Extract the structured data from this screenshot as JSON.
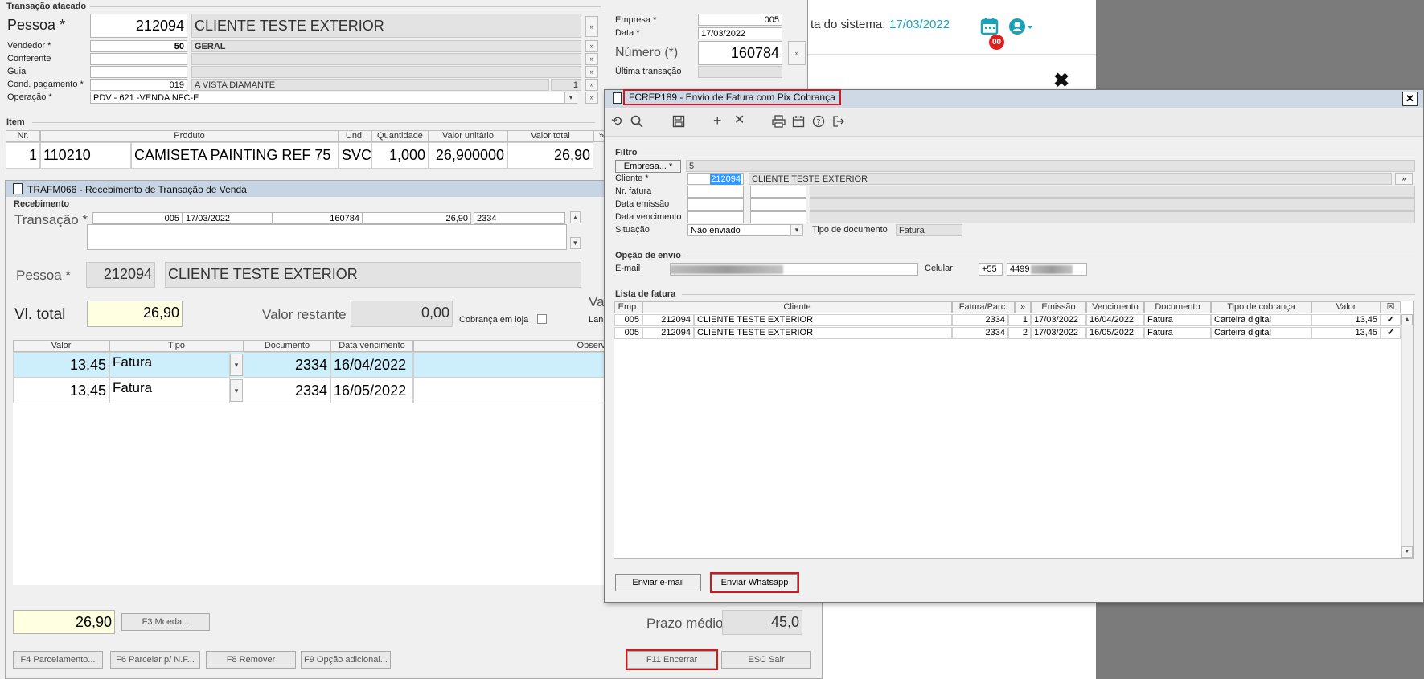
{
  "back_header": {
    "date_label": "ta do sistema:",
    "date_value": "17/03/2022",
    "badge": "00",
    "close": "✖"
  },
  "main": {
    "group_title": "Transação atacado",
    "pessoa": {
      "label": "Pessoa *",
      "code": "212094",
      "name": "CLIENTE TESTE EXTERIOR"
    },
    "vendedor": {
      "label": "Vendedor *",
      "code": "50",
      "name": "GERAL"
    },
    "conferente": {
      "label": "Conferente"
    },
    "guia": {
      "label": "Guia"
    },
    "cond_pag": {
      "label": "Cond. pagamento *",
      "code": "019",
      "name": "A VISTA DIAMANTE",
      "num": "1"
    },
    "operacao": {
      "label": "Operação *",
      "value": "PDV - 621 -VENDA NFC-E"
    },
    "empresa": {
      "label": "Empresa *",
      "value": "005"
    },
    "data": {
      "label": "Data *",
      "value": "17/03/2022"
    },
    "numero": {
      "label": "Número (*)",
      "value": "160784"
    },
    "ultima": {
      "label": "Última transação"
    },
    "item_group": "Item",
    "item_cols": [
      "Nr.",
      "Produto",
      "Und.",
      "Quantidade",
      "Valor unitário",
      "Valor total"
    ],
    "item_row": [
      "1",
      "110210",
      "CAMISETA PAINTING REF 75",
      "SVC",
      "1,000",
      "26,900000",
      "26,90"
    ]
  },
  "receb": {
    "title": "TRAFM066 - Recebimento de Transação de Venda",
    "group": "Recebimento",
    "transacao_label": "Transação *",
    "transacao": [
      "005",
      "17/03/2022",
      "160784",
      "26,90",
      "2334"
    ],
    "pessoa_label": "Pessoa *",
    "pessoa_code": "212094",
    "pessoa_name": "CLIENTE TESTE EXTERIOR",
    "vltotal_label": "Vl. total",
    "vltotal": "26,90",
    "restante_label": "Valor restante",
    "restante": "0,00",
    "cobranca": "Cobrança em loja",
    "va": "Va",
    "lan": "Lan",
    "cols": [
      "Valor",
      "Tipo",
      "Documento",
      "Data vencimento",
      "Observ"
    ],
    "rows": [
      [
        "13,45",
        "Fatura",
        "2334",
        "16/04/2022"
      ],
      [
        "13,45",
        "Fatura",
        "2334",
        "16/05/2022"
      ]
    ],
    "bottom_total": "26,90",
    "f3": "F3 Moeda...",
    "prazo_label": "Prazo médio",
    "prazo": "45,0",
    "buttons": [
      "F4 Parcelamento...",
      "F6 Parcelar p/ N.F...",
      "F8 Remover",
      "F9 Opção adicional...",
      "F11 Encerrar",
      "ESC Sair"
    ]
  },
  "dialog": {
    "title": "FCRFP189 - Envio de Fatura com Pix Cobrança",
    "close": "✕",
    "filtro": "Filtro",
    "empresa_btn": "Empresa... *",
    "empresa_val": "5",
    "cliente_label": "Cliente *",
    "cliente_code": "212094",
    "cliente_name": "CLIENTE TESTE EXTERIOR",
    "nr_fatura": "Nr. fatura",
    "data_emissao": "Data emissão",
    "data_venc": "Data vencimento",
    "situacao_label": "Situação",
    "situacao": "Não enviado",
    "tipo_doc_label": "Tipo de documento",
    "tipo_doc": "Fatura",
    "opcao_envio": "Opção de envio",
    "email_label": "E-mail",
    "celular_label": "Celular",
    "ddi": "+55",
    "cel_prefix": "4499",
    "lista": "Lista de fatura",
    "cols": [
      "Emp.",
      "Cliente",
      "Fatura/Parc.",
      "»",
      "Emissão",
      "Vencimento",
      "Documento",
      "Tipo de cobrança",
      "Valor",
      "☒"
    ],
    "rows": [
      [
        "005",
        "212094",
        "CLIENTE TESTE EXTERIOR",
        "2334",
        "1",
        "17/03/2022",
        "16/04/2022",
        "Fatura",
        "Carteira digital",
        "13,45",
        "✓"
      ],
      [
        "005",
        "212094",
        "CLIENTE TESTE EXTERIOR",
        "2334",
        "2",
        "17/03/2022",
        "16/05/2022",
        "Fatura",
        "Carteira digital",
        "13,45",
        "✓"
      ]
    ],
    "btn_email": "Enviar e-mail",
    "btn_whatsapp": "Enviar Whatsapp"
  }
}
